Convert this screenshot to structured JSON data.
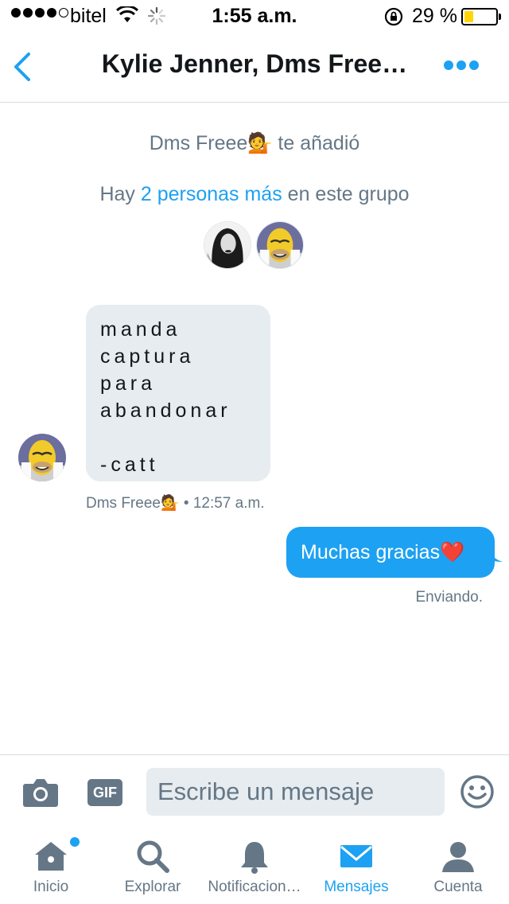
{
  "status_bar": {
    "carrier": "bitel",
    "time": "1:55 a.m.",
    "battery_percent": "29 %",
    "battery_level": 0.29,
    "signal_bars": 4
  },
  "header": {
    "title": "Kylie Jenner, Dms Free…"
  },
  "conversation": {
    "added_text": "Dms Freee💁 te añadió",
    "members_prefix": "Hay ",
    "members_link": "2 personas más",
    "members_suffix": " en este grupo",
    "incoming": {
      "text": "manda\ncaptura\npara\nabandonar\n\n-catt",
      "sender": "Dms Freee💁",
      "time": "12:57 a.m.",
      "meta": "Dms Freee💁 • 12:57 a.m."
    },
    "outgoing": {
      "text": "Muchas gracias❤️",
      "status": "Enviando."
    }
  },
  "composer": {
    "gif_label": "GIF",
    "placeholder": "Escribe un mensaje"
  },
  "tabs": [
    {
      "label": "Inicio",
      "icon": "home-icon",
      "active": false
    },
    {
      "label": "Explorar",
      "icon": "search-icon",
      "active": false
    },
    {
      "label": "Notificacion…",
      "icon": "bell-icon",
      "active": false
    },
    {
      "label": "Mensajes",
      "icon": "mail-icon",
      "active": true
    },
    {
      "label": "Cuenta",
      "icon": "person-icon",
      "active": false
    }
  ],
  "colors": {
    "accent": "#1da1f2",
    "muted": "#657786",
    "bubble_incoming": "#e6ecf0",
    "battery": "#ffd60a"
  }
}
